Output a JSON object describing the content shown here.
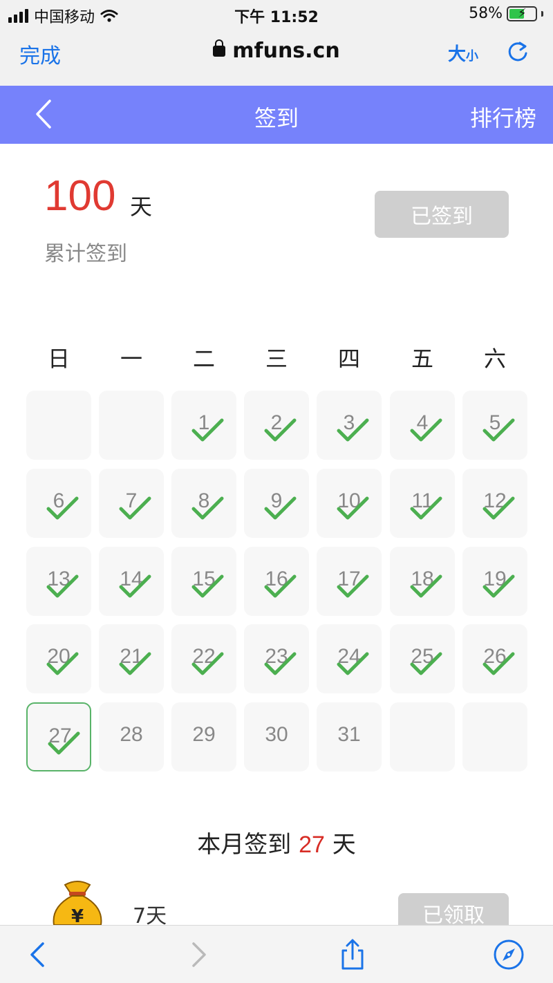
{
  "status_bar": {
    "carrier": "中国移动",
    "time": "下午 11:52",
    "battery_percent": "58%",
    "battery_level": 0.58
  },
  "browser": {
    "done_label": "完成",
    "url": "mfuns.cn",
    "text_size_big": "大",
    "text_size_small": "小"
  },
  "header": {
    "title": "签到",
    "ranking_label": "排行榜"
  },
  "summary": {
    "total_days": "100",
    "total_unit": "天",
    "total_label": "累计签到",
    "signed_button": "已签到"
  },
  "calendar": {
    "weekdays": [
      "日",
      "一",
      "二",
      "三",
      "四",
      "五",
      "六"
    ],
    "days": [
      {
        "day": "",
        "checked": false
      },
      {
        "day": "",
        "checked": false
      },
      {
        "day": "1",
        "checked": true
      },
      {
        "day": "2",
        "checked": true
      },
      {
        "day": "3",
        "checked": true
      },
      {
        "day": "4",
        "checked": true
      },
      {
        "day": "5",
        "checked": true
      },
      {
        "day": "6",
        "checked": true
      },
      {
        "day": "7",
        "checked": true
      },
      {
        "day": "8",
        "checked": true
      },
      {
        "day": "9",
        "checked": true
      },
      {
        "day": "10",
        "checked": true
      },
      {
        "day": "11",
        "checked": true
      },
      {
        "day": "12",
        "checked": true
      },
      {
        "day": "13",
        "checked": true
      },
      {
        "day": "14",
        "checked": true
      },
      {
        "day": "15",
        "checked": true
      },
      {
        "day": "16",
        "checked": true
      },
      {
        "day": "17",
        "checked": true
      },
      {
        "day": "18",
        "checked": true
      },
      {
        "day": "19",
        "checked": true
      },
      {
        "day": "20",
        "checked": true
      },
      {
        "day": "21",
        "checked": true
      },
      {
        "day": "22",
        "checked": true
      },
      {
        "day": "23",
        "checked": true
      },
      {
        "day": "24",
        "checked": true
      },
      {
        "day": "25",
        "checked": true
      },
      {
        "day": "26",
        "checked": true
      },
      {
        "day": "27",
        "checked": true,
        "today": true
      },
      {
        "day": "28",
        "checked": false
      },
      {
        "day": "29",
        "checked": false
      },
      {
        "day": "30",
        "checked": false
      },
      {
        "day": "31",
        "checked": false
      },
      {
        "day": "",
        "checked": false
      },
      {
        "day": "",
        "checked": false
      }
    ]
  },
  "month_summary": {
    "prefix": "本月签到",
    "count": "27",
    "unit": "天"
  },
  "reward": {
    "label": "7天",
    "button": "已领取",
    "icon": "money-bag-icon"
  },
  "colors": {
    "header_bg": "#7682fb",
    "accent_red": "#e03a32",
    "check_green": "#4caf50",
    "ios_blue": "#1a73e8"
  }
}
